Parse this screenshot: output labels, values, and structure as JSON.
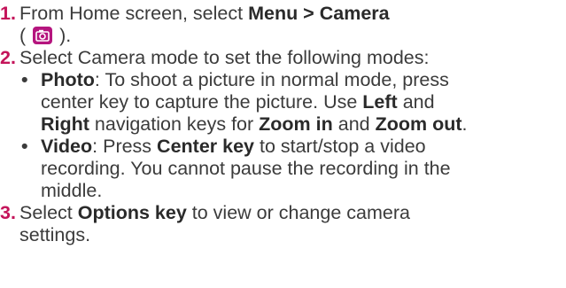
{
  "colors": {
    "step_number": "#c4145a",
    "text": "#3b3b3b",
    "camera_icon_bg": "#b5157e"
  },
  "steps": [
    {
      "number": "1.",
      "text_1": "From Home screen, select ",
      "bold_1": "Menu > Camera",
      "paren_open": "(",
      "icon": "camera-icon",
      "paren_close": ")."
    },
    {
      "number": "2.",
      "text_1": "Select Camera mode to set the following modes:",
      "bullets": [
        {
          "marker": "•",
          "bold_1": "Photo",
          "text_1": ": To shoot a picture in normal mode, press",
          "text_2": "center key to capture the picture. Use ",
          "bold_2": "Left",
          "text_3": " and",
          "bold_3": "Right",
          "text_4": " navigation keys for ",
          "bold_4": "Zoom in",
          "text_5": " and ",
          "bold_5": "Zoom out",
          "text_6": "."
        },
        {
          "marker": "•",
          "bold_1": "Video",
          "text_1": ": Press ",
          "bold_2": "Center key",
          "text_2": " to start/stop a video",
          "text_3": "recording. You cannot pause the recording in the",
          "text_4": "middle."
        }
      ]
    },
    {
      "number": "3.",
      "text_1": "Select ",
      "bold_1": "Options key",
      "text_2": " to view or change camera",
      "text_3": "settings."
    }
  ]
}
